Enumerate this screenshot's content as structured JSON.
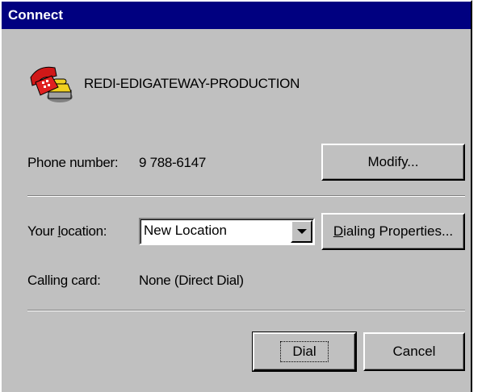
{
  "window": {
    "title": "Connect"
  },
  "connection": {
    "name": "REDI-EDIGATEWAY-PRODUCTION",
    "icon": "phone-modem-icon"
  },
  "phone": {
    "label": "Phone number:",
    "value": "9 788-6147",
    "modify_button": "Modify..."
  },
  "location": {
    "label_pre": "Your ",
    "label_access": "l",
    "label_post": "ocation:",
    "selected": "New Location",
    "dialing_access": "D",
    "dialing_rest": "ialing Properties..."
  },
  "calling_card": {
    "label": "Calling card:",
    "value": "None (Direct Dial)"
  },
  "actions": {
    "dial": "Dial",
    "cancel": "Cancel"
  },
  "colors": {
    "title_bar": "#000080",
    "dialog_bg": "#c0c0c0",
    "phone_red": "#d01818",
    "phone_yellow": "#f0d020"
  }
}
